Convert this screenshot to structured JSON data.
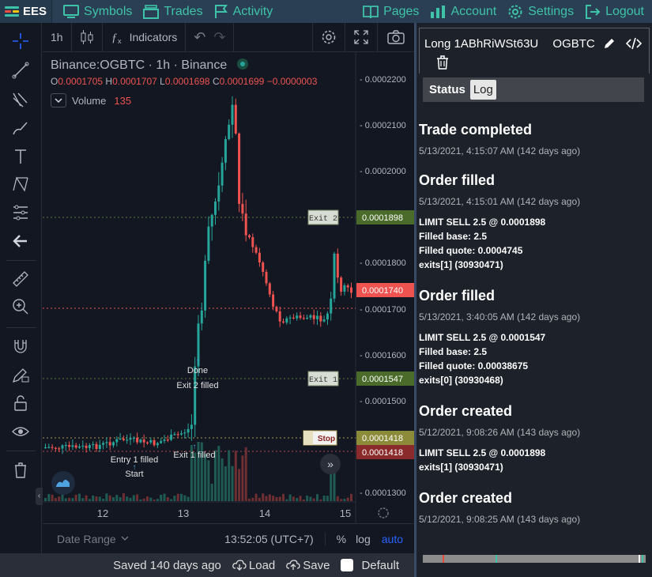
{
  "brand": {
    "name": "EES",
    "logo_colors": [
      "#3fc3a8",
      "#e74c3c",
      "#f1c40f"
    ]
  },
  "nav": {
    "symbols": "Symbols",
    "trades": "Trades",
    "activity": "Activity",
    "pages": "Pages",
    "account": "Account",
    "settings": "Settings",
    "logout": "Logout"
  },
  "chart_header": {
    "interval": "1h",
    "indicators": "Indicators"
  },
  "legend": {
    "symbol": "Binance:OGBTC · 1h · Binance"
  },
  "ohlc": {
    "o_label": "O",
    "o": "0.0001705",
    "h_label": "H",
    "h": "0.0001707",
    "l_label": "L",
    "l": "0.0001698",
    "c_label": "C",
    "c": "0.0001699",
    "change": "−0.0000003"
  },
  "volume": {
    "label": "Volume",
    "value": "135"
  },
  "price_axis": [
    "0.0002200",
    "0.0002100",
    "0.0002000",
    "0.0001800",
    "0.0001700",
    "0.0001600",
    "0.0001500",
    "0.0001300"
  ],
  "price_tags": {
    "exit2": "0.0001898",
    "current": "0.0001740",
    "exit1": "0.0001547",
    "stop": "0.0001418",
    "liq": "0.0001418"
  },
  "chart_labels": {
    "exit2": "Exit 2",
    "exit1": "Exit 1",
    "stop": "Stop",
    "done": "Done",
    "exit2_filled": "Exit 2 filled",
    "entry1_filled": "Entry 1 filled",
    "exit1_filled": "Exit 1 filled",
    "start": "Start"
  },
  "time_axis": [
    "12",
    "13",
    "14",
    "15"
  ],
  "axis_footer": {
    "date_range": "Date Range",
    "clock": "13:52:05 (UTC+7)",
    "pct": "%",
    "log": "log",
    "auto": "auto"
  },
  "bottom": {
    "saved": "Saved 140 days ago",
    "load": "Load",
    "save": "Save",
    "default": "Default"
  },
  "trade": {
    "title": "Long 1ABhRiWSt63U",
    "symbol": "OGBTC"
  },
  "tabs": {
    "status": "Status",
    "log": "Log"
  },
  "events": [
    {
      "title": "Trade completed",
      "time": "5/13/2021, 4:15:07 AM (142 days ago)",
      "lines": []
    },
    {
      "title": "Order filled",
      "time": "5/13/2021, 4:15:01 AM (142 days ago)",
      "lines": [
        "LIMIT SELL 2.5 @ 0.0001898",
        "Filled base: 2.5",
        "Filled quote: 0.0004745",
        "exits[1] (30930471)"
      ]
    },
    {
      "title": "Order filled",
      "time": "5/13/2021, 3:40:05 AM (142 days ago)",
      "lines": [
        "LIMIT SELL 2.5 @ 0.0001547",
        "Filled base: 2.5",
        "Filled quote: 0.00038675",
        "exits[0] (30930468)"
      ]
    },
    {
      "title": "Order created",
      "time": "5/12/2021, 9:08:26 AM (143 days ago)",
      "lines": [
        "LIMIT SELL 2.5 @ 0.0001898",
        "exits[1] (30930471)"
      ]
    },
    {
      "title": "Order created",
      "time": "5/12/2021, 9:08:25 AM (143 days ago)",
      "lines": []
    }
  ]
}
